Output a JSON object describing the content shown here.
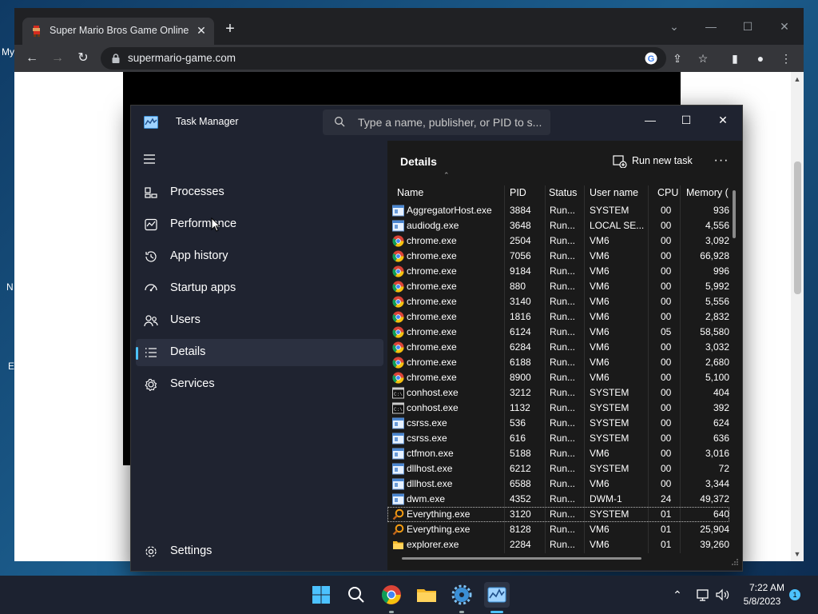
{
  "desktop": {
    "partial_labels": [
      "My",
      "N",
      "E"
    ]
  },
  "browser": {
    "tab_title": "Super Mario Bros Game Online",
    "url": "supermario-game.com",
    "new_tab_symbol": "+"
  },
  "task_manager": {
    "title": "Task Manager",
    "search_placeholder": "Type a name, publisher, or PID to s...",
    "nav": [
      {
        "label": "Processes",
        "icon": "processes-icon"
      },
      {
        "label": "Performance",
        "icon": "performance-icon"
      },
      {
        "label": "App history",
        "icon": "app-history-icon"
      },
      {
        "label": "Startup apps",
        "icon": "startup-apps-icon"
      },
      {
        "label": "Users",
        "icon": "users-icon"
      },
      {
        "label": "Details",
        "icon": "details-icon",
        "active": true
      },
      {
        "label": "Services",
        "icon": "services-icon"
      }
    ],
    "settings_label": "Settings",
    "details": {
      "title": "Details",
      "run_new_task": "Run new task",
      "more": "···",
      "columns": [
        "Name",
        "PID",
        "Status",
        "User name",
        "CPU",
        "Memory ("
      ],
      "rows": [
        {
          "icon": "service",
          "name": "AggregatorHost.exe",
          "pid": "3884",
          "status": "Run...",
          "user": "SYSTEM",
          "cpu": "00",
          "mem": "936"
        },
        {
          "icon": "service",
          "name": "audiodg.exe",
          "pid": "3648",
          "status": "Run...",
          "user": "LOCAL SE...",
          "cpu": "00",
          "mem": "4,556"
        },
        {
          "icon": "chrome",
          "name": "chrome.exe",
          "pid": "2504",
          "status": "Run...",
          "user": "VM6",
          "cpu": "00",
          "mem": "3,092"
        },
        {
          "icon": "chrome",
          "name": "chrome.exe",
          "pid": "7056",
          "status": "Run...",
          "user": "VM6",
          "cpu": "00",
          "mem": "66,928"
        },
        {
          "icon": "chrome",
          "name": "chrome.exe",
          "pid": "9184",
          "status": "Run...",
          "user": "VM6",
          "cpu": "00",
          "mem": "996"
        },
        {
          "icon": "chrome",
          "name": "chrome.exe",
          "pid": "880",
          "status": "Run...",
          "user": "VM6",
          "cpu": "00",
          "mem": "5,992"
        },
        {
          "icon": "chrome",
          "name": "chrome.exe",
          "pid": "3140",
          "status": "Run...",
          "user": "VM6",
          "cpu": "00",
          "mem": "5,556"
        },
        {
          "icon": "chrome",
          "name": "chrome.exe",
          "pid": "1816",
          "status": "Run...",
          "user": "VM6",
          "cpu": "00",
          "mem": "2,832"
        },
        {
          "icon": "chrome",
          "name": "chrome.exe",
          "pid": "6124",
          "status": "Run...",
          "user": "VM6",
          "cpu": "05",
          "mem": "58,580"
        },
        {
          "icon": "chrome",
          "name": "chrome.exe",
          "pid": "6284",
          "status": "Run...",
          "user": "VM6",
          "cpu": "00",
          "mem": "3,032"
        },
        {
          "icon": "chrome",
          "name": "chrome.exe",
          "pid": "6188",
          "status": "Run...",
          "user": "VM6",
          "cpu": "00",
          "mem": "2,680"
        },
        {
          "icon": "chrome",
          "name": "chrome.exe",
          "pid": "8900",
          "status": "Run...",
          "user": "VM6",
          "cpu": "00",
          "mem": "5,100"
        },
        {
          "icon": "console",
          "name": "conhost.exe",
          "pid": "3212",
          "status": "Run...",
          "user": "SYSTEM",
          "cpu": "00",
          "mem": "404"
        },
        {
          "icon": "console",
          "name": "conhost.exe",
          "pid": "1132",
          "status": "Run...",
          "user": "SYSTEM",
          "cpu": "00",
          "mem": "392"
        },
        {
          "icon": "service",
          "name": "csrss.exe",
          "pid": "536",
          "status": "Run...",
          "user": "SYSTEM",
          "cpu": "00",
          "mem": "624"
        },
        {
          "icon": "service",
          "name": "csrss.exe",
          "pid": "616",
          "status": "Run...",
          "user": "SYSTEM",
          "cpu": "00",
          "mem": "636"
        },
        {
          "icon": "service",
          "name": "ctfmon.exe",
          "pid": "5188",
          "status": "Run...",
          "user": "VM6",
          "cpu": "00",
          "mem": "3,016"
        },
        {
          "icon": "service",
          "name": "dllhost.exe",
          "pid": "6212",
          "status": "Run...",
          "user": "SYSTEM",
          "cpu": "00",
          "mem": "72"
        },
        {
          "icon": "service",
          "name": "dllhost.exe",
          "pid": "6588",
          "status": "Run...",
          "user": "VM6",
          "cpu": "00",
          "mem": "3,344"
        },
        {
          "icon": "service",
          "name": "dwm.exe",
          "pid": "4352",
          "status": "Run...",
          "user": "DWM-1",
          "cpu": "24",
          "mem": "49,372"
        },
        {
          "icon": "everything",
          "name": "Everything.exe",
          "pid": "3120",
          "status": "Run...",
          "user": "SYSTEM",
          "cpu": "01",
          "mem": "640",
          "selected": true
        },
        {
          "icon": "everything",
          "name": "Everything.exe",
          "pid": "8128",
          "status": "Run...",
          "user": "VM6",
          "cpu": "01",
          "mem": "25,904"
        },
        {
          "icon": "folder",
          "name": "explorer.exe",
          "pid": "2284",
          "status": "Run...",
          "user": "VM6",
          "cpu": "01",
          "mem": "39,260"
        }
      ]
    }
  },
  "taskbar": {
    "apps": [
      {
        "name": "start-button",
        "running": false
      },
      {
        "name": "search-button",
        "running": false
      },
      {
        "name": "chrome-taskbar-button",
        "running": true
      },
      {
        "name": "file-explorer-taskbar-button",
        "running": false
      },
      {
        "name": "app-taskbar-button",
        "running": true
      },
      {
        "name": "task-manager-taskbar-button",
        "running": true,
        "active": true
      }
    ],
    "time": "7:22 AM",
    "date": "5/8/2023",
    "notification_count": "1"
  },
  "colors": {
    "accent": "#4cc2ff",
    "tm_bg": "#1f2330",
    "details_bg": "#1a1a1a"
  }
}
